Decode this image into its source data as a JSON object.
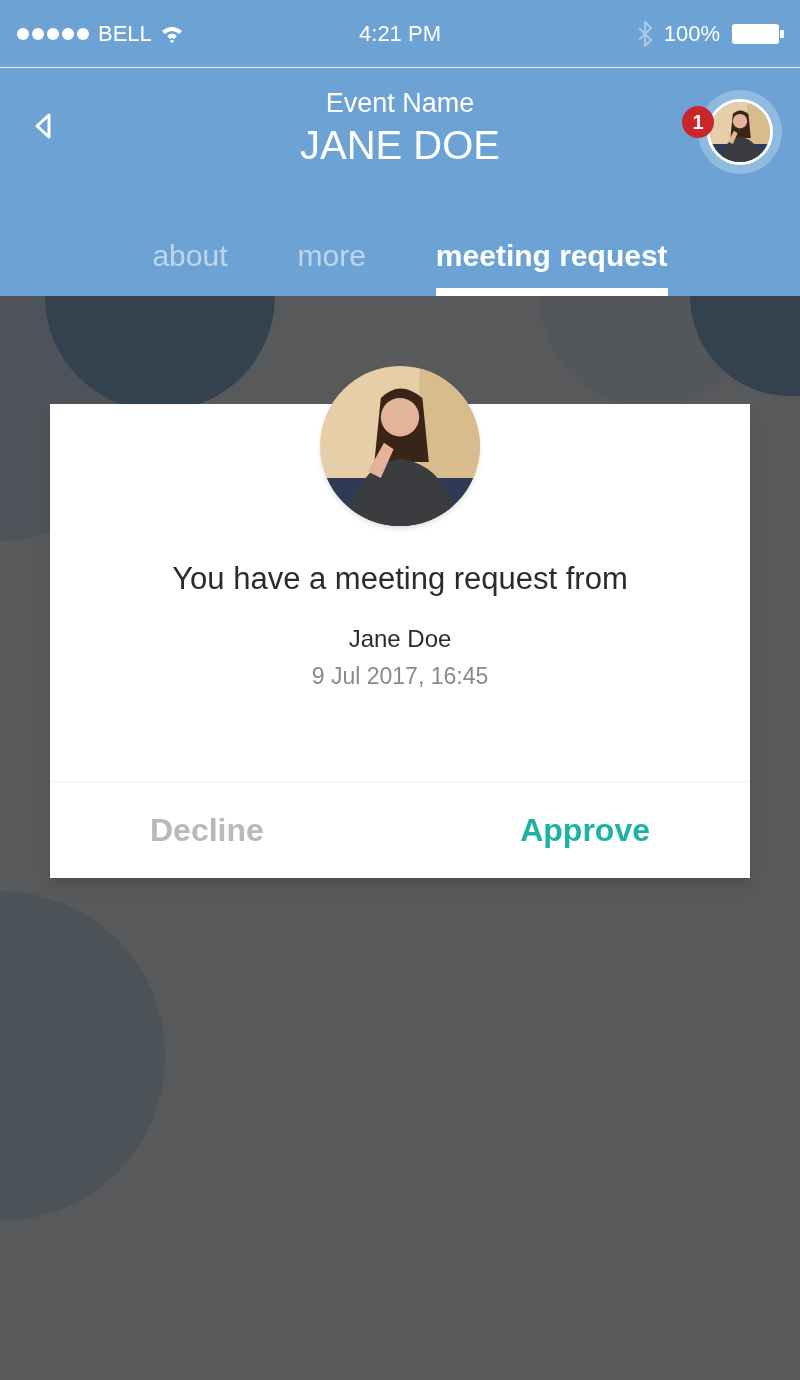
{
  "status_bar": {
    "carrier": "BELL",
    "time": "4:21 PM",
    "battery": "100%"
  },
  "header": {
    "subtitle": "Event Name",
    "title": "JANE DOE",
    "badge": "1"
  },
  "tabs": [
    {
      "label": "about",
      "selected": false
    },
    {
      "label": "more",
      "selected": false
    },
    {
      "label": "meeting request",
      "selected": true
    }
  ],
  "card": {
    "message": "You have a meeting request from",
    "name": "Jane Doe",
    "datetime": "9 Jul 2017, 16:45",
    "actions": [
      {
        "label": "Decline",
        "kind": "decline"
      },
      {
        "label": "Approve",
        "kind": "approve"
      }
    ]
  }
}
